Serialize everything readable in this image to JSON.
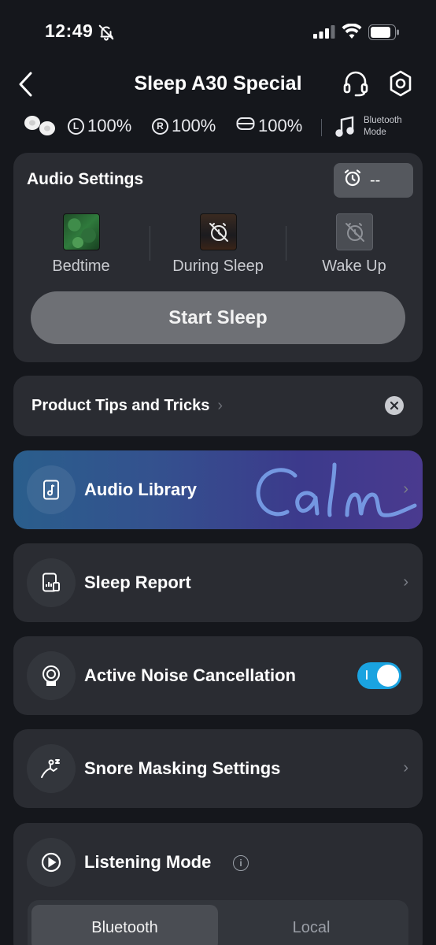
{
  "status_bar": {
    "time": "12:49"
  },
  "header": {
    "title": "Sleep A30 Special"
  },
  "battery": {
    "left_letter": "L",
    "left": "100%",
    "right_letter": "R",
    "right": "100%",
    "case": "100%",
    "mode_line1": "Bluetooth",
    "mode_line2": "Mode"
  },
  "audio_settings": {
    "title": "Audio Settings",
    "alarm_value": "--",
    "tabs": [
      {
        "label": "Bedtime"
      },
      {
        "label": "During Sleep"
      },
      {
        "label": "Wake Up"
      }
    ],
    "start_button": "Start Sleep"
  },
  "tips": {
    "label": "Product Tips and Tricks"
  },
  "audio_library": {
    "label": "Audio Library",
    "brand": "Calm"
  },
  "sleep_report": {
    "label": "Sleep Report"
  },
  "anc": {
    "label": "Active Noise Cancellation",
    "enabled": true
  },
  "snore": {
    "label": "Snore Masking Settings"
  },
  "listening_mode": {
    "label": "Listening Mode",
    "info": "i",
    "options": [
      "Bluetooth",
      "Local"
    ],
    "selected": "Bluetooth"
  },
  "colors": {
    "background": "#15171c",
    "card": "#2a2c32",
    "toggle_on": "#1aa3e0"
  }
}
